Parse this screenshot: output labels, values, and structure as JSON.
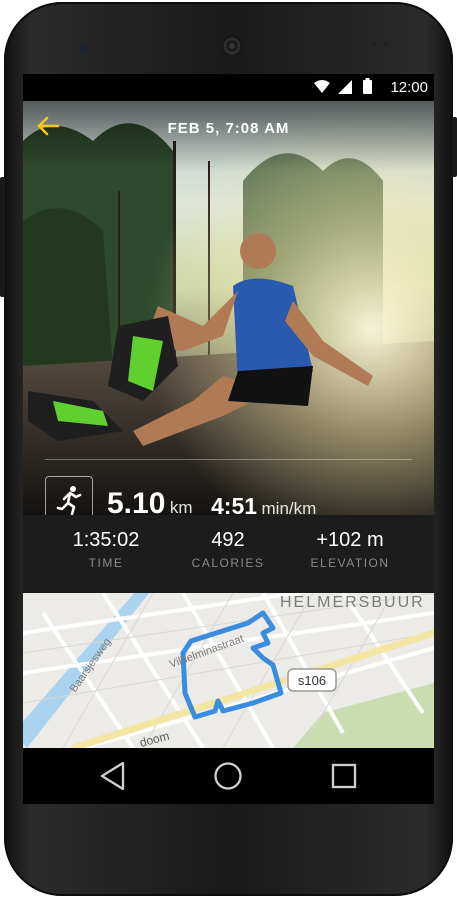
{
  "status_bar": {
    "time": "12:00",
    "icons": [
      "wifi-icon",
      "signal-icon",
      "battery-icon"
    ]
  },
  "header": {
    "date": "FEB 5, 7:08 AM",
    "back_icon": "back-arrow-icon"
  },
  "summary": {
    "activity_icon": "running-icon",
    "distance_value": "5.10",
    "distance_unit": "km",
    "pace_value": "4:51",
    "pace_unit": "min/km"
  },
  "stats": [
    {
      "value": "1:35:02",
      "label": "TIME"
    },
    {
      "value": "492",
      "label": "CALORIES"
    },
    {
      "value": "+102 m",
      "label": "ELEVATION"
    }
  ],
  "map": {
    "district_label": "HELMERSBUUR",
    "street_1": "Baarsjesweg",
    "street_2": "Vilhelminastraat",
    "street_3": "doom",
    "road_badge": "s106"
  },
  "nav_bar": {
    "icons": [
      "back-triangle-icon",
      "home-circle-icon",
      "recents-square-icon"
    ]
  },
  "colors": {
    "accent": "#F5C518",
    "route": "#3A8DDE",
    "stats_bg": "#1C1C1C",
    "map_bg": "#ECEBE7",
    "park": "#C9DDB0",
    "canal": "#A9D3EE"
  }
}
